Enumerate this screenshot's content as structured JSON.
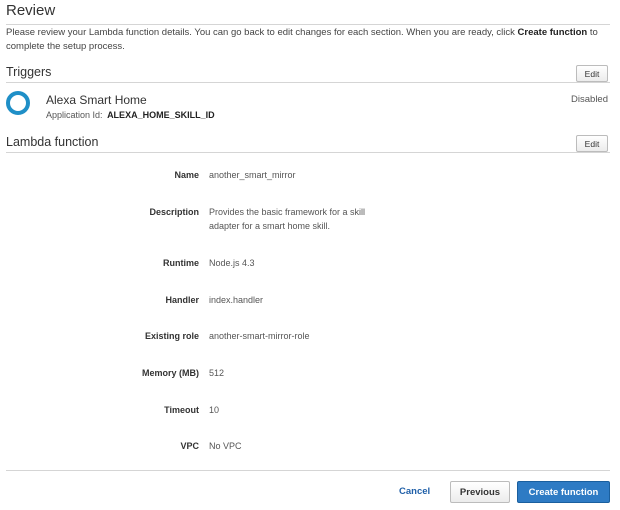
{
  "page": {
    "title": "Review",
    "intro_part1": "Please review your Lambda function details. You can go back to edit changes for each section. When you are ready, click ",
    "intro_bold": "Create function",
    "intro_part2": " to complete the setup process."
  },
  "triggers": {
    "title": "Triggers",
    "edit_label": "Edit",
    "item": {
      "name": "Alexa Smart Home",
      "app_id_label": "Application Id:",
      "app_id_value": "ALEXA_HOME_SKILL_ID",
      "status": "Disabled",
      "icon": "alexa-ring-icon",
      "icon_color": "#1f8fc7"
    }
  },
  "lambda": {
    "title": "Lambda function",
    "edit_label": "Edit",
    "details": [
      {
        "label": "Name",
        "value": "another_smart_mirror"
      },
      {
        "label": "Description",
        "value": "Provides the basic framework for a skill adapter for a smart home skill."
      },
      {
        "label": "Runtime",
        "value": "Node.js 4.3"
      },
      {
        "label": "Handler",
        "value": "index.handler"
      },
      {
        "label": "Existing role",
        "value": "another-smart-mirror-role"
      },
      {
        "label": "Memory (MB)",
        "value": "512"
      },
      {
        "label": "Timeout",
        "value": "10"
      },
      {
        "label": "VPC",
        "value": "No VPC"
      }
    ]
  },
  "footer": {
    "cancel_label": "Cancel",
    "previous_label": "Previous",
    "create_label": "Create function",
    "primary_color": "#2e7bc4"
  }
}
